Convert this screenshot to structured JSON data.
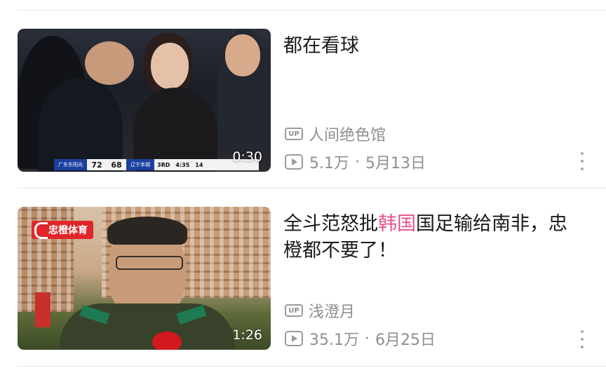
{
  "videos": [
    {
      "title": "都在看球",
      "title_segments": [],
      "uploader": "人间绝色馆",
      "up_badge": "UP",
      "views": "5.1万",
      "date": "5月13日",
      "duration": "0:30",
      "thumbnail_icon": "basketball-crowd-thumbnail",
      "scorebar": {
        "team_a": "广东东阳光",
        "score_a": "72",
        "score_b": "68",
        "team_b": "辽宁本钢",
        "quarter": "3RD",
        "clock": "4:35",
        "shot_clock": "14"
      }
    },
    {
      "title_segments": [
        {
          "text": "全斗范怒批",
          "highlight": false
        },
        {
          "text": "韩国",
          "highlight": true
        },
        {
          "text": "国足输给南非，忠橙都不要了！",
          "highlight": false
        }
      ],
      "uploader": "浅澄月",
      "up_badge": "UP",
      "views": "35.1万",
      "date": "6月25日",
      "duration": "1:26",
      "thumbnail_icon": "officer-interview-thumbnail",
      "channel_logo": "忠橙体育"
    }
  ],
  "separator": "·",
  "colors": {
    "highlight": "#e8518f",
    "meta_text": "#8f8f8f",
    "title_text": "#1a1a1a"
  },
  "icons": {
    "up": "up-badge-icon",
    "views": "play-count-icon",
    "more": "more-vertical-icon"
  }
}
